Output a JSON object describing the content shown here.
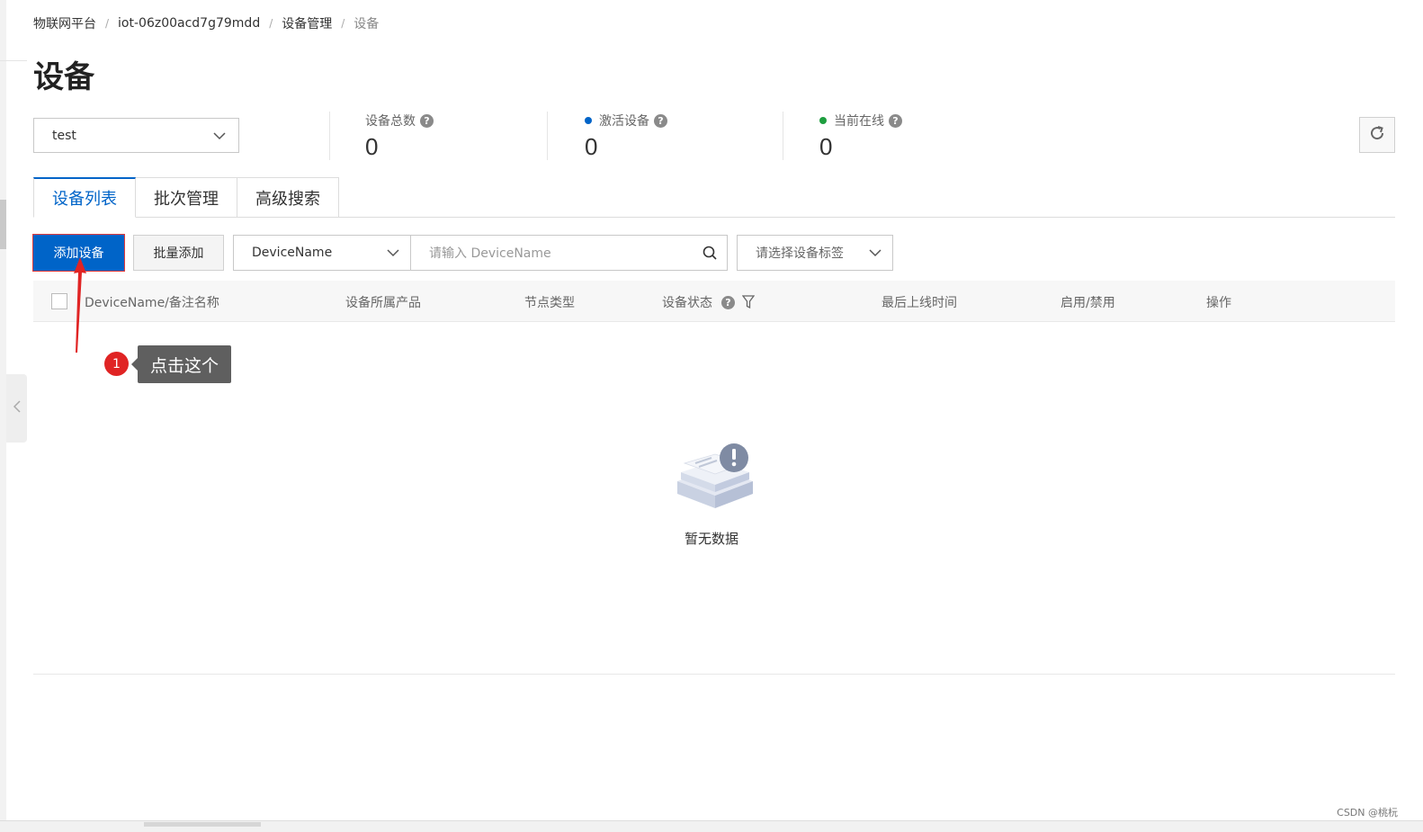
{
  "breadcrumb": {
    "items": [
      "物联网平台",
      "iot-06z00acd7g79mdd",
      "设备管理",
      "设备"
    ],
    "separator": "/"
  },
  "page_title": "设备",
  "product_select": {
    "value": "test"
  },
  "stats": {
    "total": {
      "label": "设备总数",
      "value": "0"
    },
    "activated": {
      "label": "激活设备",
      "value": "0",
      "dot_color": "#0064c8"
    },
    "online": {
      "label": "当前在线",
      "value": "0",
      "dot_color": "#1e9e3f"
    }
  },
  "help_mark": "?",
  "tabs": [
    {
      "label": "设备列表",
      "active": true
    },
    {
      "label": "批次管理",
      "active": false
    },
    {
      "label": "高级搜索",
      "active": false
    }
  ],
  "toolbar": {
    "add_device_label": "添加设备",
    "batch_add_label": "批量添加",
    "field_select_value": "DeviceName",
    "search_placeholder": "请输入 DeviceName",
    "tag_select_placeholder": "请选择设备标签"
  },
  "table": {
    "columns": [
      "DeviceName/备注名称",
      "设备所属产品",
      "节点类型",
      "设备状态",
      "最后上线时间",
      "启用/禁用",
      "操作"
    ],
    "empty_text": "暂无数据"
  },
  "annotation": {
    "step": "1",
    "text": "点击这个",
    "color": "#e02424"
  },
  "watermark": "CSDN @桃杬",
  "icons": {
    "collapse": "chevron-left-icon",
    "refresh": "refresh-icon",
    "search": "search-icon",
    "filter": "filter-icon",
    "empty": "empty-data-icon"
  },
  "colors": {
    "primary": "#0064c8",
    "annotation": "#e02424"
  }
}
